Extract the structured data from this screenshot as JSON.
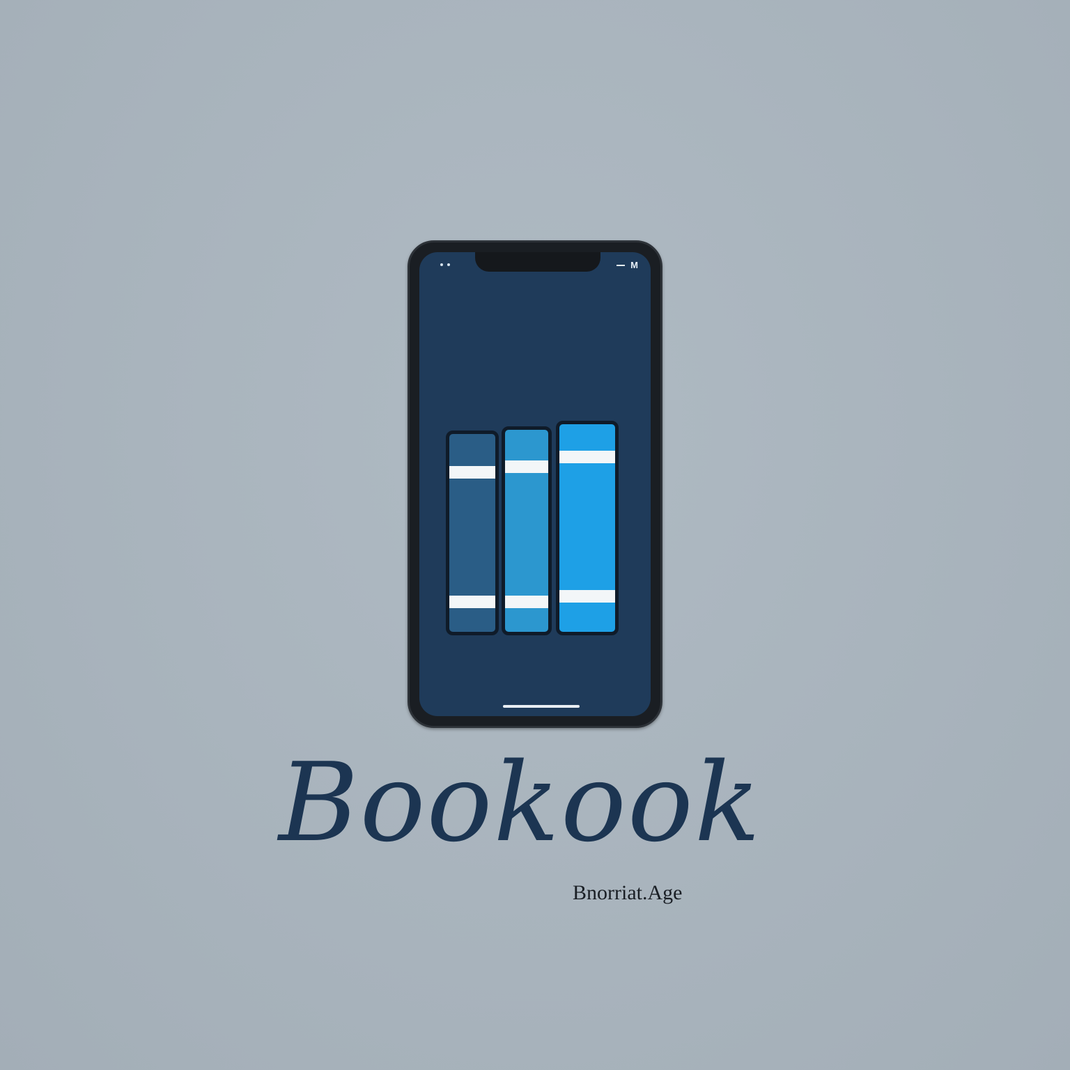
{
  "device": {
    "status_bar_right": "M"
  },
  "screen": {
    "background": "#1f3b5a",
    "icon": "book-stack-icon",
    "books": [
      {
        "color": "#2a5d86"
      },
      {
        "color": "#2c97cf"
      },
      {
        "color": "#1ea0e6"
      }
    ],
    "band_color": "#f3f6f8"
  },
  "branding": {
    "logo_text": "Bookook",
    "tagline": "Bnorriat.Age",
    "color": "#1c3552"
  }
}
